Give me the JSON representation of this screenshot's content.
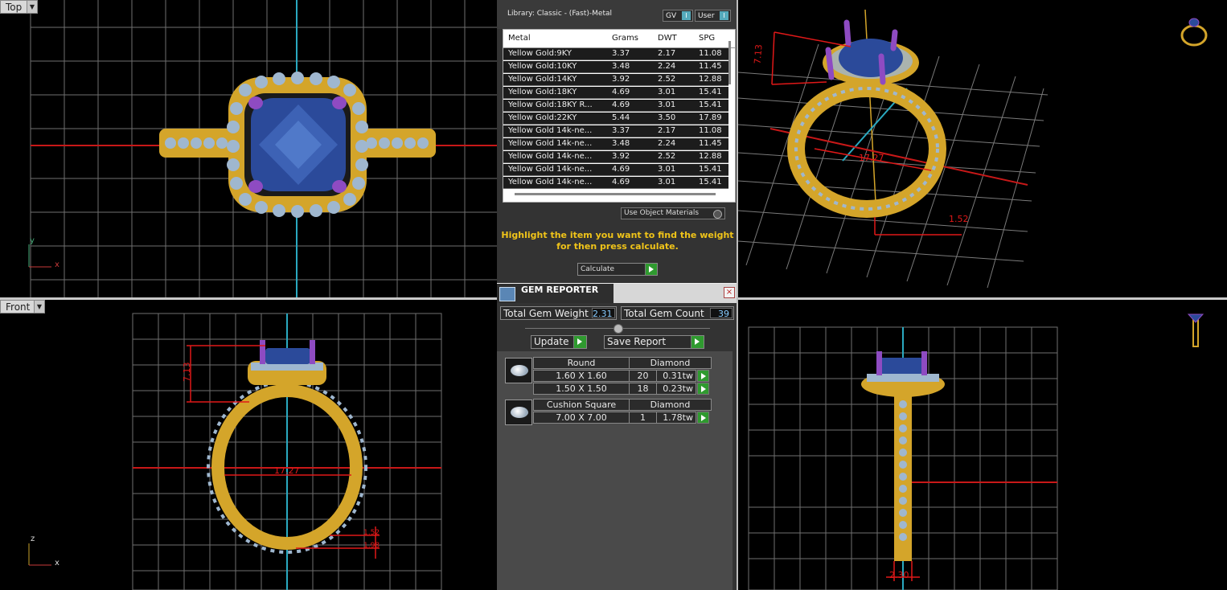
{
  "viewports": {
    "top": {
      "label": "Top",
      "axis_a": "x",
      "axis_b": "y"
    },
    "front": {
      "label": "Front",
      "axis_a": "x",
      "axis_b": "z"
    },
    "perspective": {
      "dim_height": "7.13",
      "dim_width": "17.27",
      "dim_base": "1.52"
    },
    "front_dims": {
      "height": "7.13",
      "width": "17.27",
      "d1": "1.52",
      "d2": "1.98"
    },
    "side_dims": {
      "width": "2.30"
    }
  },
  "metal_library": {
    "title": "Library: Classic - (Fast)-Metal",
    "toggle_gv": "GV",
    "toggle_user": "User",
    "columns": [
      "Metal",
      "Grams",
      "DWT",
      "SPG"
    ],
    "rows": [
      [
        "Yellow Gold:9KY",
        "3.37",
        "2.17",
        "11.08"
      ],
      [
        "Yellow Gold:10KY",
        "3.48",
        "2.24",
        "11.45"
      ],
      [
        "Yellow Gold:14KY",
        "3.92",
        "2.52",
        "12.88"
      ],
      [
        "Yellow Gold:18KY",
        "4.69",
        "3.01",
        "15.41"
      ],
      [
        "Yellow Gold:18KY R...",
        "4.69",
        "3.01",
        "15.41"
      ],
      [
        "Yellow Gold:22KY",
        "5.44",
        "3.50",
        "17.89"
      ],
      [
        "Yellow Gold 14k-ne...",
        "3.37",
        "2.17",
        "11.08"
      ],
      [
        "Yellow Gold 14k-ne...",
        "3.48",
        "2.24",
        "11.45"
      ],
      [
        "Yellow Gold 14k-ne...",
        "3.92",
        "2.52",
        "12.88"
      ],
      [
        "Yellow Gold 14k-ne...",
        "4.69",
        "3.01",
        "15.41"
      ],
      [
        "Yellow Gold 14k-ne...",
        "4.69",
        "3.01",
        "15.41"
      ]
    ],
    "use_object_materials": "Use Object Materials",
    "hint_line1": "Highlight the item you want to find the weight",
    "hint_line2": "for then press calculate.",
    "calculate_label": "Calculate"
  },
  "gem_reporter": {
    "title": "GEM REPORTER",
    "close": "×",
    "total_weight_label": "Total Gem Weight",
    "total_weight_value": "2.31",
    "total_count_label": "Total Gem Count",
    "total_count_value": "39",
    "update_label": "Update",
    "save_report_label": "Save Report",
    "groups": [
      {
        "shape": "Round",
        "material": "Diamond",
        "rows": [
          {
            "size": "1.60 X 1.60",
            "count": "20",
            "weight": "0.31tw"
          },
          {
            "size": "1.50 X 1.50",
            "count": "18",
            "weight": "0.23tw"
          }
        ]
      },
      {
        "shape": "Cushion Square",
        "material": "Diamond",
        "rows": [
          {
            "size": "7.00 X 7.00",
            "count": "1",
            "weight": "1.78tw"
          }
        ]
      }
    ]
  },
  "colors": {
    "gold": "#d4a52a",
    "sapphire": "#2b4a9a",
    "prong": "#8e4bc2",
    "diamond": "#9fb7cf",
    "grid": "#6f6f6f",
    "dimension": "#e01818",
    "accent_green": "#2f9a2f"
  },
  "icons": [
    "ring-perspective-icon",
    "ring-side-icon",
    "gem-reporter-icon",
    "dropdown-arrow-icon",
    "go-arrow-icon",
    "close-icon"
  ]
}
